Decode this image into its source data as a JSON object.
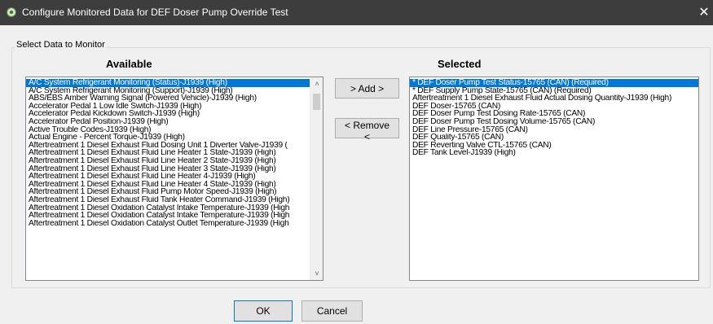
{
  "window": {
    "title": "Configure Monitored Data for DEF Doser Pump Override Test",
    "close_glyph": "✕"
  },
  "group_label": "Select Data to Monitor",
  "available": {
    "header": "Available",
    "items": [
      "A/C System Refrigerant Monitoring (Status)-J1939 (High)",
      "A/C System Refrigerant Monitoring (Support)-J1939 (High)",
      "ABS/EBS Amber Warning Signal (Powered Vehicle)-J1939 (High)",
      "Accelerator Pedal 1 Low Idle Switch-J1939 (High)",
      "Accelerator Pedal Kickdown Switch-J1939 (High)",
      "Accelerator Pedal Position-J1939 (High)",
      "Active Trouble Codes-J1939 (High)",
      "Actual Engine - Percent Torque-J1939 (High)",
      "Aftertreatment 1 Diesel Exhaust Fluid Dosing Unit 1 Diverter Valve-J1939 (",
      "Aftertreatment 1 Diesel Exhaust Fluid Line Heater 1 State-J1939 (High)",
      "Aftertreatment 1 Diesel Exhaust Fluid Line Heater 2 State-J1939 (High)",
      "Aftertreatment 1 Diesel Exhaust Fluid Line Heater 3 State-J1939 (High)",
      "Aftertreatment 1 Diesel Exhaust Fluid Line Heater 4-J1939 (High)",
      "Aftertreatment 1 Diesel Exhaust Fluid Line Heater 4 State-J1939 (High)",
      "Aftertreatment 1 Diesel Exhaust Fluid Pump Motor Speed-J1939 (High)",
      "Aftertreatment 1 Diesel Exhaust Fluid Tank Heater Command-J1939 (High)",
      "Aftertreatment 1 Diesel Oxidation Catalyst Intake Temperature-J1939 (High",
      "Aftertreatment 1 Diesel Oxidation Catalyst Intake Temperature-J1939 (High",
      "Aftertreatment 1 Diesel Oxidation Catalyst Outlet Temperature-J1939 (High"
    ]
  },
  "selected": {
    "header": "Selected",
    "items": [
      "* DEF Doser Pump Test Status-15765 (CAN) (Required)",
      "* DEF Supply Pump State-15765 (CAN) (Required)",
      "Aftertreatment 1 Diesel Exhaust Fluid Actual Dosing Quantity-J1939 (High)",
      "DEF Doser-15765 (CAN)",
      "DEF Doser Pump Test Dosing Rate-15765 (CAN)",
      "DEF Doser Pump Test Dosing Volume-15765 (CAN)",
      "DEF Line Pressure-15765 (CAN)",
      "DEF Quality-15765 (CAN)",
      "DEF Reverting Valve CTL-15765 (CAN)",
      "DEF Tank Level-J1939 (High)"
    ]
  },
  "buttons": {
    "add": "> Add >",
    "remove": "< Remove <",
    "ok": "OK",
    "cancel": "Cancel"
  },
  "scroll": {
    "up_glyph": "˄",
    "down_glyph": "˅"
  },
  "colors": {
    "selection": "#0078d7",
    "titlebar": "#3d3d3d"
  }
}
